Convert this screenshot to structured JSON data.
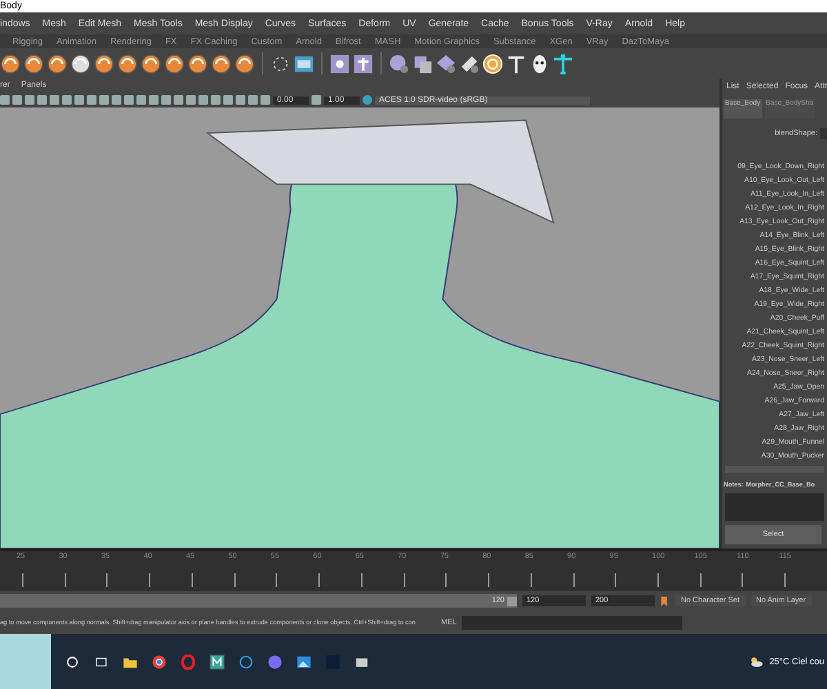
{
  "window": {
    "title": "Body"
  },
  "menu": [
    "indows",
    "Mesh",
    "Edit Mesh",
    "Mesh Tools",
    "Mesh Display",
    "Curves",
    "Surfaces",
    "Deform",
    "UV",
    "Generate",
    "Cache",
    "Bonus Tools",
    "V-Ray",
    "Arnold",
    "Help"
  ],
  "shelf_tabs": [
    {
      "label": "Rigging",
      "selected": false
    },
    {
      "label": "Animation",
      "selected": false
    },
    {
      "label": "Rendering",
      "selected": false
    },
    {
      "label": "FX",
      "selected": false
    },
    {
      "label": "FX Caching",
      "selected": false
    },
    {
      "label": "Custom",
      "selected": false
    },
    {
      "label": "Arnold",
      "selected": false
    },
    {
      "label": "Bifrost",
      "selected": false
    },
    {
      "label": "MASH",
      "selected": false
    },
    {
      "label": "Motion Graphics",
      "selected": false
    },
    {
      "label": "Substance",
      "selected": false
    },
    {
      "label": "XGen",
      "selected": false
    },
    {
      "label": "VRay",
      "selected": false
    },
    {
      "label": "DazToMaya",
      "selected": false
    }
  ],
  "panel_menu": [
    "rer",
    "Panels"
  ],
  "viewport_toolbar": {
    "exposure": "0.00",
    "gamma": "1.00",
    "color_space": "ACES 1.0 SDR-video (sRGB)"
  },
  "side_panel": {
    "tabs": [
      "List",
      "Selected",
      "Focus",
      "Attr"
    ],
    "node_tabs": [
      {
        "label": "Base_Body",
        "selected": true
      },
      {
        "label": "Base_BodySha",
        "selected": false
      }
    ],
    "blendshape_label": "blendShape:",
    "targets": [
      "09_Eye_Look_Down_Right",
      "A10_Eye_Look_Out_Left",
      "A11_Eye_Look_In_Left",
      "A12_Eye_Look_In_Right",
      "A13_Eye_Look_Out_Right",
      "A14_Eye_Blink_Left",
      "A15_Eye_Blink_Right",
      "A16_Eye_Squint_Left",
      "A17_Eye_Squint_Right",
      "A18_Eye_Wide_Left",
      "A19_Eye_Wide_Right",
      "A20_Cheek_Puff",
      "A21_Cheek_Squint_Left",
      "A22_Cheek_Squint_Right",
      "A23_Nose_Sneer_Left",
      "A24_Nose_Sneer_Right",
      "A25_Jaw_Open",
      "A26_Jaw_Forward",
      "A27_Jaw_Left",
      "A28_Jaw_Right",
      "A29_Mouth_Funnel",
      "A30_Mouth_Pucker"
    ],
    "notes_label": "Notes:",
    "notes_value": "Morpher_CC_Base_Bo",
    "button": "Select"
  },
  "timeline": {
    "ticks": [
      "25",
      "30",
      "35",
      "40",
      "45",
      "50",
      "55",
      "60",
      "65",
      "70",
      "75",
      "80",
      "85",
      "90",
      "95",
      "100",
      "105",
      "110",
      "115"
    ]
  },
  "range": {
    "level": 1,
    "slider_end": "120",
    "start": "120",
    "end": "200",
    "character_set": "No Character Set",
    "anim_layer": "No Anim Layer"
  },
  "help_line": "ag to move components along normals. Shift+drag manipulator axis or plane handles to extrude components or clone objects. Ctrl+Shift+drag to con",
  "command_line": {
    "label": "MEL"
  },
  "taskbar": {
    "weather": "25°C  Ciel cou"
  }
}
